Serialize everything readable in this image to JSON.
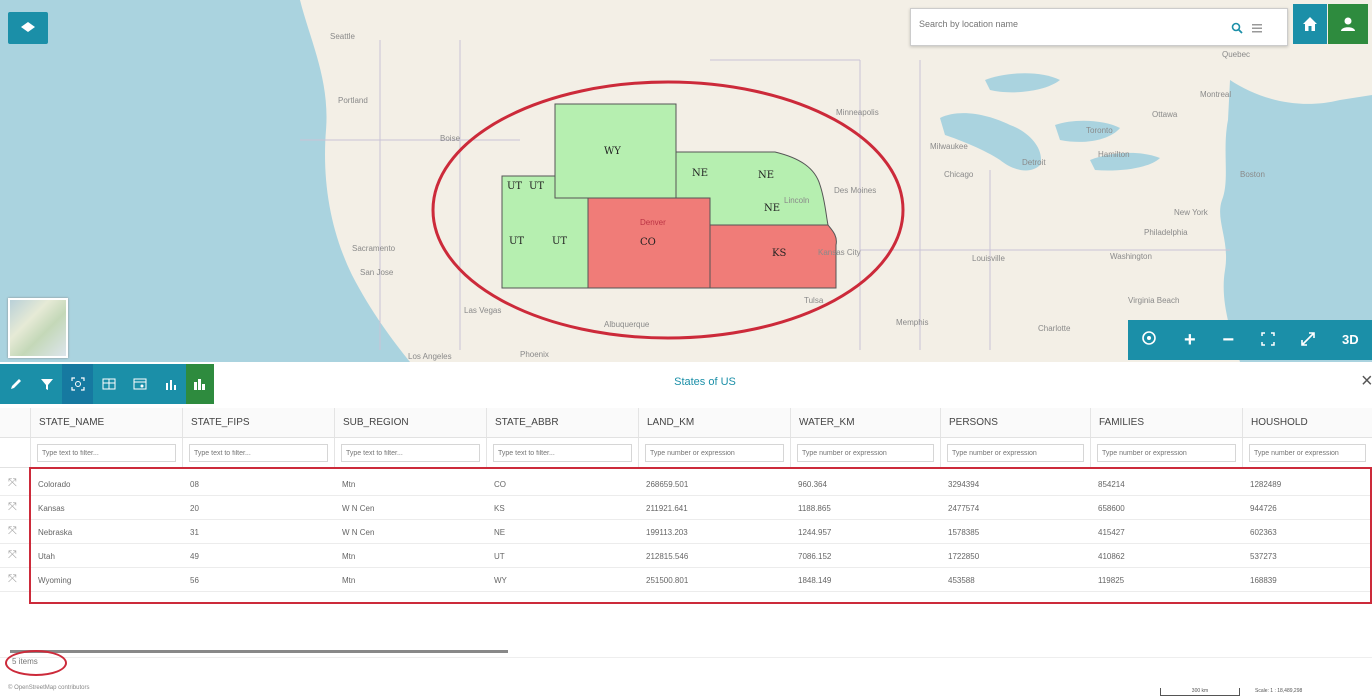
{
  "map": {
    "places": [
      {
        "name": "Seattle"
      },
      {
        "name": "Portland"
      },
      {
        "name": "Boise"
      },
      {
        "name": "Sacramento"
      },
      {
        "name": "San Jose"
      },
      {
        "name": "Las Vegas"
      },
      {
        "name": "Los Angeles"
      },
      {
        "name": "Phoenix"
      },
      {
        "name": "Albuquerque"
      },
      {
        "name": "Denver"
      },
      {
        "name": "Tulsa"
      },
      {
        "name": "Memphis"
      },
      {
        "name": "Minneapolis"
      },
      {
        "name": "Milwaukee"
      },
      {
        "name": "Chicago"
      },
      {
        "name": "Detroit"
      },
      {
        "name": "Des Moines"
      },
      {
        "name": "Kansas City"
      },
      {
        "name": "Louisville"
      },
      {
        "name": "Toronto"
      },
      {
        "name": "Ottawa"
      },
      {
        "name": "Montreal"
      },
      {
        "name": "Quebec"
      },
      {
        "name": "Boston"
      },
      {
        "name": "New York"
      },
      {
        "name": "Philadelphia"
      },
      {
        "name": "Washington"
      },
      {
        "name": "Virginia Beach"
      },
      {
        "name": "Charlotte"
      },
      {
        "name": "Lincoln"
      },
      {
        "name": "Hamilton"
      }
    ],
    "state_labels": [
      {
        "text": "WY"
      },
      {
        "text": "NE"
      },
      {
        "text": "NE"
      },
      {
        "text": "NE"
      },
      {
        "text": "UT"
      },
      {
        "text": "UT"
      },
      {
        "text": "UT"
      },
      {
        "text": "UT"
      },
      {
        "text": "CO"
      },
      {
        "text": "KS"
      }
    ],
    "state_colors": {
      "selected_green": "#b6efb0",
      "highlight_red": "#f07c78"
    },
    "annotation_color": "#cc2a3a"
  },
  "search": {
    "placeholder": "Search by location name"
  },
  "icons": {
    "layers": "layers-icon",
    "search": "search-icon",
    "menu": "menu-icon",
    "home": "home-icon",
    "user": "user-icon",
    "locate": "locate-icon",
    "zoom_in": "plus-icon",
    "zoom_out": "minus-icon",
    "extent": "extent-icon",
    "fullscreen": "fullscreen-icon",
    "edit": "edit-icon",
    "filter": "filter-icon",
    "zoom_selected": "zoom-to-icon",
    "table": "table-icon",
    "table_settings": "table-settings-icon",
    "chart": "chart-icon",
    "widgets": "widgets-icon",
    "close": "close-icon"
  },
  "mapnav": {
    "three_d_label": "3D"
  },
  "grid": {
    "title": "States of US",
    "columns": [
      {
        "label": "STATE_NAME",
        "filter_placeholder": "Type text to filter..."
      },
      {
        "label": "STATE_FIPS",
        "filter_placeholder": "Type text to filter..."
      },
      {
        "label": "SUB_REGION",
        "filter_placeholder": "Type text to filter..."
      },
      {
        "label": "STATE_ABBR",
        "filter_placeholder": "Type text to filter..."
      },
      {
        "label": "LAND_KM",
        "filter_placeholder": "Type number or expression"
      },
      {
        "label": "WATER_KM",
        "filter_placeholder": "Type number or expression"
      },
      {
        "label": "PERSONS",
        "filter_placeholder": "Type number or expression"
      },
      {
        "label": "FAMILIES",
        "filter_placeholder": "Type number or expression"
      },
      {
        "label": "HOUSHOLD",
        "filter_placeholder": "Type number or expression"
      }
    ],
    "rows": [
      [
        "Colorado",
        "08",
        "Mtn",
        "CO",
        "268659.501",
        "960.364",
        "3294394",
        "854214",
        "1282489"
      ],
      [
        "Kansas",
        "20",
        "W N Cen",
        "KS",
        "211921.641",
        "1188.865",
        "2477574",
        "658600",
        "944726"
      ],
      [
        "Nebraska",
        "31",
        "W N Cen",
        "NE",
        "199113.203",
        "1244.957",
        "1578385",
        "415427",
        "602363"
      ],
      [
        "Utah",
        "49",
        "Mtn",
        "UT",
        "212815.546",
        "7086.152",
        "1722850",
        "410862",
        "537273"
      ],
      [
        "Wyoming",
        "56",
        "Mtn",
        "WY",
        "251500.801",
        "1848.149",
        "453588",
        "119825",
        "168839"
      ]
    ],
    "items_count": "5 items"
  },
  "footer": {
    "attribution": "© OpenStreetMap contributors",
    "scale_bar": "300 km",
    "scale_text": "Scale: 1 : 18,489,298"
  }
}
